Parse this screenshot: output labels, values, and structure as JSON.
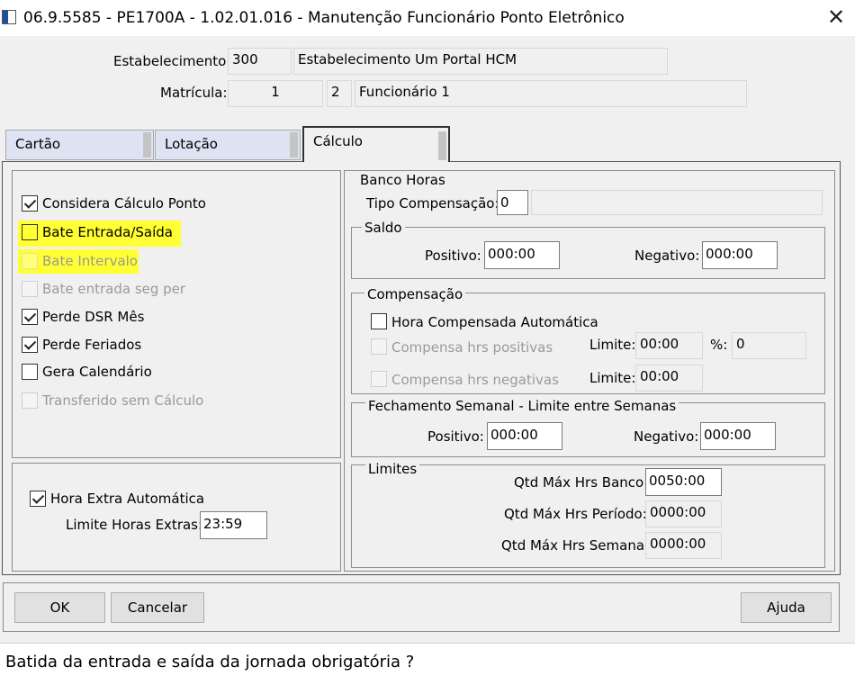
{
  "window": {
    "title": "06.9.5585 - PE1700A - 1.02.01.016 - Manutenção Funcionário Ponto Eletrônico",
    "close_glyph": "✕"
  },
  "header": {
    "estabelecimento_label": "Estabelecimento:",
    "estabelecimento_code": "300",
    "estabelecimento_name": "Estabelecimento Um Portal HCM",
    "matricula_label": "Matrícula:",
    "matricula_value": "1",
    "funcionario_code": "2",
    "funcionario_name": "Funcionário 1"
  },
  "tabs": [
    {
      "label": "Cartão",
      "active": false
    },
    {
      "label": "Lotação",
      "active": false
    },
    {
      "label": "Cálculo",
      "active": true
    }
  ],
  "left_panel": {
    "checkboxes": [
      {
        "label": "Considera Cálculo Ponto",
        "checked": true,
        "enabled": true,
        "highlighted": false
      },
      {
        "label": "Bate Entrada/Saída",
        "checked": false,
        "enabled": true,
        "highlighted": true
      },
      {
        "label": "Bate Intervalo",
        "checked": false,
        "enabled": false,
        "highlighted": true
      },
      {
        "label": "Bate entrada seg per",
        "checked": false,
        "enabled": false,
        "highlighted": false
      },
      {
        "label": "Perde DSR Mês",
        "checked": true,
        "enabled": true,
        "highlighted": false
      },
      {
        "label": "Perde Feriados",
        "checked": true,
        "enabled": true,
        "highlighted": false
      },
      {
        "label": "Gera Calendário",
        "checked": false,
        "enabled": true,
        "highlighted": false
      },
      {
        "label": "Transferido sem Cálculo",
        "checked": false,
        "enabled": false,
        "highlighted": false
      }
    ],
    "hora_extra": {
      "label": "Hora Extra Automática",
      "checked": true,
      "limite_label": "Limite Horas Extras:",
      "limite_value": "23:59"
    }
  },
  "banco_horas": {
    "title": "Banco Horas",
    "tipo_label": "Tipo Compensação:",
    "tipo_value": "0",
    "tipo_desc": "",
    "saldo": {
      "title": "Saldo",
      "positivo_label": "Positivo:",
      "positivo_value": "000:00",
      "negativo_label": "Negativo:",
      "negativo_value": "000:00"
    },
    "compensacao": {
      "title": "Compensação",
      "hora_comp_label": "Hora Compensada Automática",
      "hora_comp_checked": false,
      "positivas_label": "Compensa hrs positivas",
      "negativas_label": "Compensa hrs negativas",
      "limite_label": "Limite:",
      "limite_pos_value": "00:00",
      "pct_label": "%:",
      "pct_value": "0",
      "limite_neg_value": "00:00"
    },
    "fechamento": {
      "title": "Fechamento Semanal - Limite entre Semanas",
      "positivo_label": "Positivo:",
      "positivo_value": "000:00",
      "negativo_label": "Negativo:",
      "negativo_value": "000:00"
    },
    "limites": {
      "title": "Limites",
      "banco_label": "Qtd Máx Hrs Banco:",
      "banco_value": "0050:00",
      "periodo_label": "Qtd Máx Hrs Período:",
      "periodo_value": "0000:00",
      "semana_label": "Qtd Máx Hrs Semana:",
      "semana_value": "0000:00"
    }
  },
  "buttons": {
    "ok": "OK",
    "cancelar": "Cancelar",
    "ajuda": "Ajuda"
  },
  "status": {
    "message": "Batida da entrada e saída da jornada obrigatória ?"
  },
  "colors": {
    "highlight": "#ffff33",
    "tab_inactive": "#dde3f2",
    "window_bg": "#f0f0f0"
  }
}
